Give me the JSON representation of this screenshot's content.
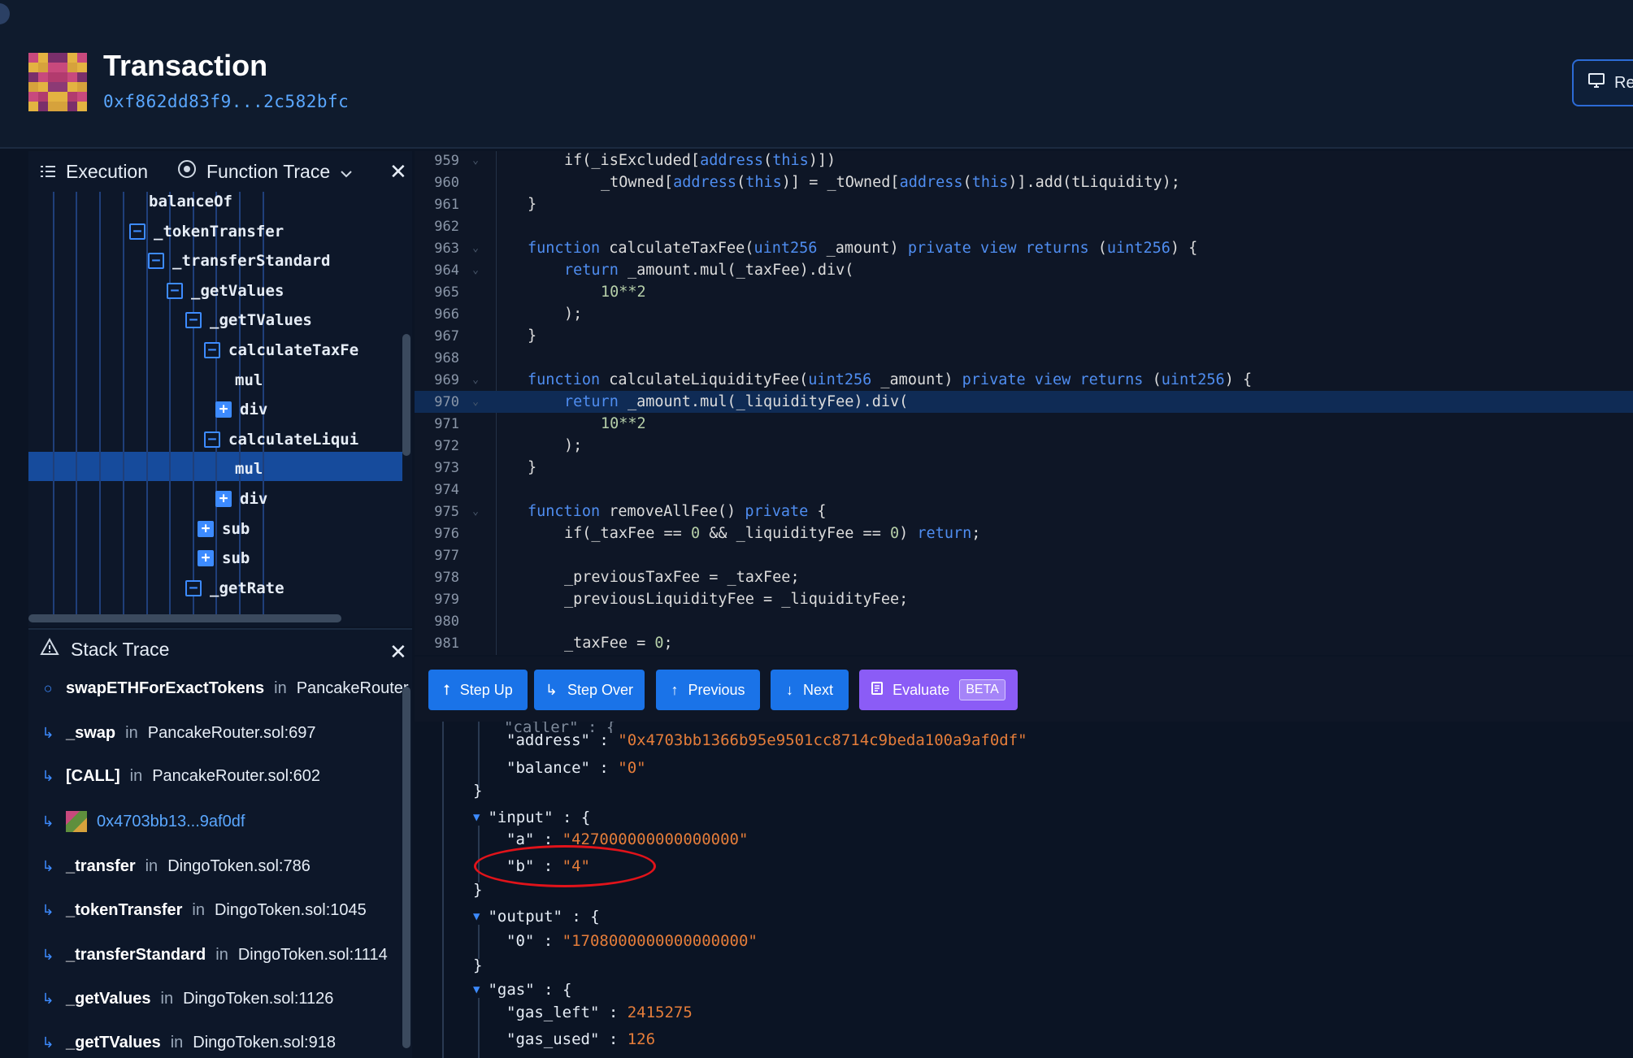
{
  "header": {
    "title": "Transaction",
    "hash": "0xf862dd83f9...2c582bfc",
    "replay_label": "Re"
  },
  "execution_panel": {
    "tab_execution": "Execution",
    "tab_function_trace": "Function Trace",
    "tree": [
      {
        "label": "balanceOf",
        "marker": "none"
      },
      {
        "label": "_tokenTransfer",
        "marker": "minus"
      },
      {
        "label": "_transferStandard",
        "marker": "minus"
      },
      {
        "label": "_getValues",
        "marker": "minus"
      },
      {
        "label": "_getTValues",
        "marker": "minus"
      },
      {
        "label": "calculateTaxFe",
        "marker": "minus"
      },
      {
        "label": "mul",
        "marker": "none"
      },
      {
        "label": "div",
        "marker": "plus"
      },
      {
        "label": "calculateLiqui",
        "marker": "minus"
      },
      {
        "label": "mul",
        "marker": "none",
        "selected": true
      },
      {
        "label": "div",
        "marker": "plus"
      },
      {
        "label": "sub",
        "marker": "plus"
      },
      {
        "label": "sub",
        "marker": "plus"
      },
      {
        "label": "_getRate",
        "marker": "minus"
      }
    ]
  },
  "stack_trace": {
    "title": "Stack Trace",
    "in_word": "in",
    "items": [
      {
        "fn": "swapETHForExactTokens",
        "file": "PancakeRouter",
        "icon": "circle-icon"
      },
      {
        "fn": "_swap",
        "file": "PancakeRouter.sol:697",
        "icon": "return-arrow-icon"
      },
      {
        "fn": "[CALL]",
        "file": "PancakeRouter.sol:602",
        "icon": "return-arrow-icon"
      },
      {
        "fn": "0x4703bb13...9af0df",
        "file": "",
        "icon": "return-arrow-icon",
        "address": true
      },
      {
        "fn": "_transfer",
        "file": "DingoToken.sol:786",
        "icon": "return-arrow-icon"
      },
      {
        "fn": "_tokenTransfer",
        "file": "DingoToken.sol:1045",
        "icon": "return-arrow-icon"
      },
      {
        "fn": "_transferStandard",
        "file": "DingoToken.sol:1114",
        "icon": "return-arrow-icon"
      },
      {
        "fn": "_getValues",
        "file": "DingoToken.sol:1126",
        "icon": "return-arrow-icon"
      },
      {
        "fn": "_getTValues",
        "file": "DingoToken.sol:918",
        "icon": "return-arrow-icon"
      }
    ]
  },
  "code": {
    "highlighted_line": "970",
    "lines": [
      {
        "n": "959",
        "fold": true,
        "indent": 1,
        "text": "if(_isExcluded[address(this)])"
      },
      {
        "n": "960",
        "fold": false,
        "indent": 2,
        "text": "_tOwned[address(this)] = _tOwned[address(this)].add(tLiquidity);"
      },
      {
        "n": "961",
        "fold": false,
        "indent": 0,
        "text": "}"
      },
      {
        "n": "962",
        "fold": false,
        "indent": 0,
        "text": ""
      },
      {
        "n": "963",
        "fold": true,
        "indent": 0,
        "text": "function calculateTaxFee(uint256 _amount) private view returns (uint256) {"
      },
      {
        "n": "964",
        "fold": true,
        "indent": 1,
        "text": "return _amount.mul(_taxFee).div("
      },
      {
        "n": "965",
        "fold": false,
        "indent": 2,
        "text": "10**2"
      },
      {
        "n": "966",
        "fold": false,
        "indent": 1,
        "text": ");"
      },
      {
        "n": "967",
        "fold": false,
        "indent": 0,
        "text": "}"
      },
      {
        "n": "968",
        "fold": false,
        "indent": 0,
        "text": ""
      },
      {
        "n": "969",
        "fold": true,
        "indent": 0,
        "text": "function calculateLiquidityFee(uint256 _amount) private view returns (uint256) {"
      },
      {
        "n": "970",
        "fold": true,
        "indent": 1,
        "text": "return _amount.mul(_liquidityFee).div("
      },
      {
        "n": "971",
        "fold": false,
        "indent": 2,
        "text": "10**2"
      },
      {
        "n": "972",
        "fold": false,
        "indent": 1,
        "text": ");"
      },
      {
        "n": "973",
        "fold": false,
        "indent": 0,
        "text": "}"
      },
      {
        "n": "974",
        "fold": false,
        "indent": 0,
        "text": ""
      },
      {
        "n": "975",
        "fold": true,
        "indent": 0,
        "text": "function removeAllFee() private {"
      },
      {
        "n": "976",
        "fold": false,
        "indent": 1,
        "text": "if(_taxFee == 0 && _liquidityFee == 0) return;"
      },
      {
        "n": "977",
        "fold": false,
        "indent": 0,
        "text": ""
      },
      {
        "n": "978",
        "fold": false,
        "indent": 1,
        "text": "_previousTaxFee = _taxFee;"
      },
      {
        "n": "979",
        "fold": false,
        "indent": 1,
        "text": "_previousLiquidityFee = _liquidityFee;"
      },
      {
        "n": "980",
        "fold": false,
        "indent": 0,
        "text": ""
      },
      {
        "n": "981",
        "fold": false,
        "indent": 1,
        "text": "_taxFee = 0;"
      }
    ]
  },
  "toolbar": {
    "step_up": "Step Up",
    "step_over": "Step Over",
    "previous": "Previous",
    "next": "Next",
    "evaluate": "Evaluate",
    "beta": "BETA"
  },
  "json_view": {
    "address_key": "\"address\"",
    "address_val": "\"0x4703bb1366b95e9501cc8714c9beda100a9af0df\"",
    "balance_key": "\"balance\"",
    "balance_val": "\"0\"",
    "input_key": "\"input\"",
    "a_key": "\"a\"",
    "a_val": "\"427000000000000000\"",
    "b_key": "\"b\"",
    "b_val": "\"4\"",
    "output_key": "\"output\"",
    "zero_key": "\"0\"",
    "zero_val": "\"1708000000000000000\"",
    "gas_key": "\"gas\"",
    "gas_left_key": "\"gas_left\"",
    "gas_left_val": "2415275",
    "gas_used_key": "\"gas_used\"",
    "gas_used_val": "126"
  },
  "colors": {
    "accent": "#1a73e8",
    "evaluate": "#8b5cf6",
    "string": "#e57d3a",
    "annotation": "#e1131a"
  }
}
